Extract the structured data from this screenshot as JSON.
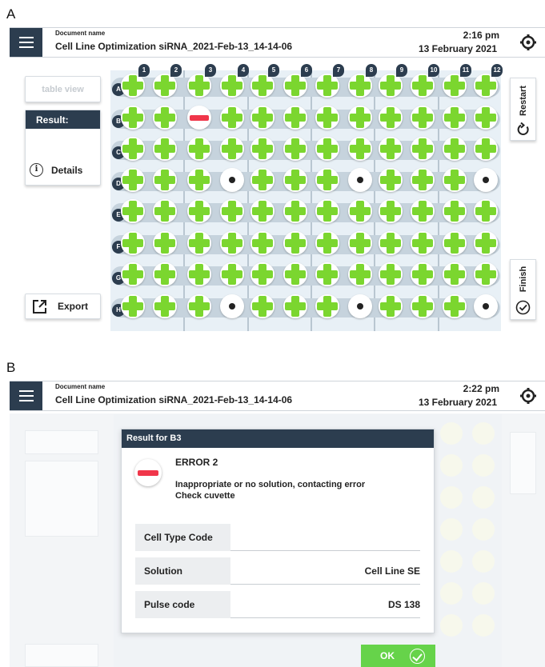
{
  "panels": {
    "a": "A",
    "b": "B"
  },
  "header_a": {
    "doc_label": "Document name",
    "doc_name": "Cell Line Optimization siRNA_2021-Feb-13_14-14-06",
    "time": "2:16 pm",
    "date": "13 February 2021"
  },
  "header_b": {
    "doc_label": "Document name",
    "doc_name": "Cell Line Optimization siRNA_2021-Feb-13_14-14-06",
    "time": "2:22 pm",
    "date": "13 February 2021"
  },
  "left_panel": {
    "table_view": "table view",
    "result_label": "Result:",
    "details": "Details",
    "export": "Export"
  },
  "right_panel": {
    "restart": "Restart",
    "finish": "Finish"
  },
  "plate": {
    "columns": [
      "1",
      "2",
      "3",
      "4",
      "5",
      "6",
      "7",
      "8",
      "9",
      "10",
      "11",
      "12"
    ],
    "rows": [
      "A",
      "B",
      "C",
      "D",
      "E",
      "F",
      "G",
      "H"
    ],
    "wells": [
      [
        "plus",
        "plus",
        "plus",
        "plus",
        "plus",
        "plus",
        "plus",
        "plus",
        "plus",
        "plus",
        "plus",
        "plus"
      ],
      [
        "plus",
        "plus",
        "minus",
        "plus",
        "plus",
        "plus",
        "plus",
        "plus",
        "plus",
        "plus",
        "plus",
        "plus"
      ],
      [
        "plus",
        "plus",
        "plus",
        "plus",
        "plus",
        "plus",
        "plus",
        "plus",
        "plus",
        "plus",
        "plus",
        "plus"
      ],
      [
        "plus",
        "plus",
        "plus",
        "dot",
        "plus",
        "plus",
        "plus",
        "dot",
        "plus",
        "plus",
        "plus",
        "dot"
      ],
      [
        "plus",
        "plus",
        "plus",
        "plus",
        "plus",
        "plus",
        "plus",
        "plus",
        "plus",
        "plus",
        "plus",
        "plus"
      ],
      [
        "plus",
        "plus",
        "plus",
        "plus",
        "plus",
        "plus",
        "plus",
        "plus",
        "plus",
        "plus",
        "plus",
        "plus"
      ],
      [
        "plus",
        "plus",
        "plus",
        "plus",
        "plus",
        "plus",
        "plus",
        "plus",
        "plus",
        "plus",
        "plus",
        "plus"
      ],
      [
        "plus",
        "plus",
        "plus",
        "dot",
        "plus",
        "plus",
        "plus",
        "dot",
        "plus",
        "plus",
        "plus",
        "dot"
      ]
    ],
    "colors": {
      "plus": "#7bd62f",
      "minus": "#f0364a",
      "dot": "#222222"
    }
  },
  "dialog": {
    "title": "Result for B3",
    "error_title": "ERROR 2",
    "error_line1": "Inappropriate or no solution, contacting error",
    "error_line2": "Check cuvette",
    "fields": [
      {
        "label": "Cell Type Code",
        "value": ""
      },
      {
        "label": "Solution",
        "value": "Cell Line SE"
      },
      {
        "label": "Pulse code",
        "value": "DS 138"
      }
    ],
    "ok": "OK"
  },
  "theme": {
    "navy": "#2c3d4f",
    "green": "#66d34a",
    "red": "#f0364a"
  }
}
